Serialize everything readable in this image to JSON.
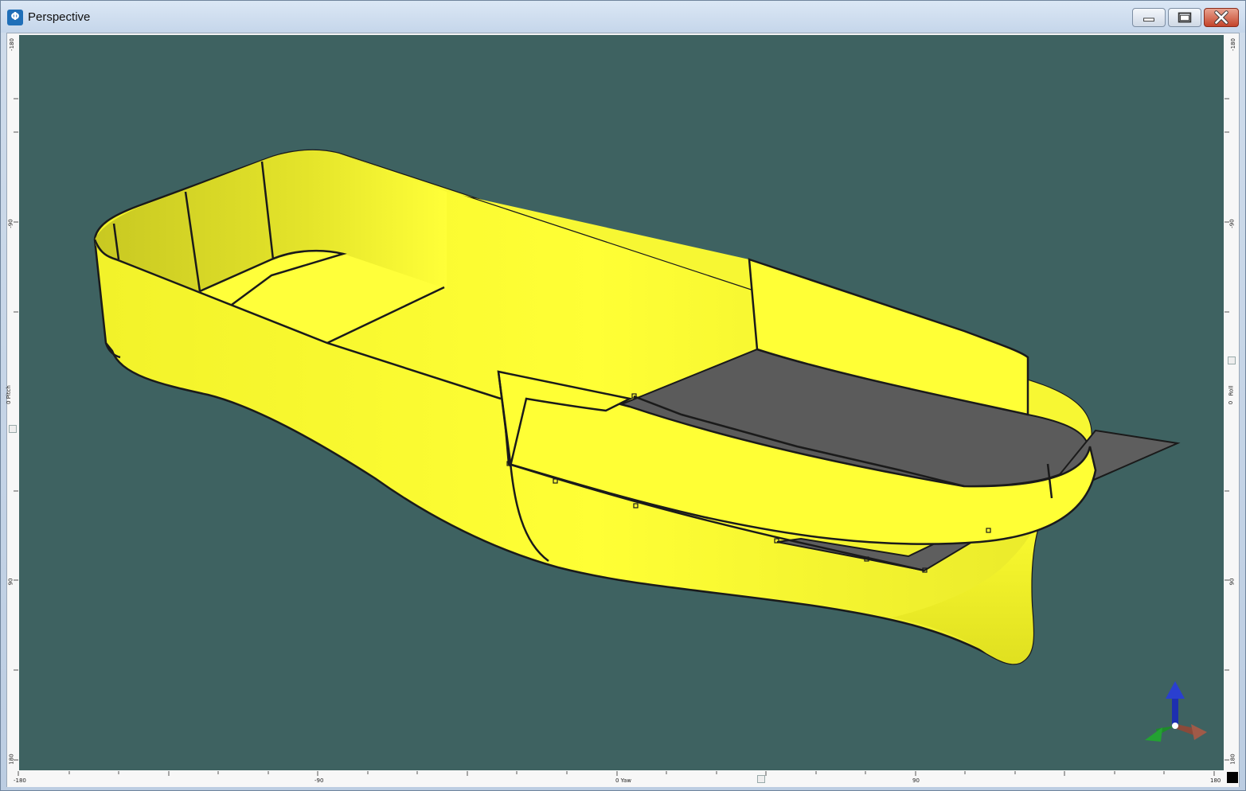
{
  "window": {
    "title": "Perspective",
    "icon": "maxsurf-app-icon"
  },
  "controls": [
    "minimize-icon",
    "maximize-icon",
    "close-icon"
  ],
  "colors": {
    "background": "#3e6261",
    "hull": "#ffff33",
    "deck": "#5a5a5a",
    "edges": "#1a1a1a"
  },
  "rulers": {
    "left": {
      "top": "-180",
      "upper_mid": "-90",
      "axis": "0 Pitch",
      "lower_mid": "90",
      "bottom": "180"
    },
    "right": {
      "top": "-180",
      "upper_mid": "-90",
      "axis": "Roll",
      "axis_value": "0",
      "lower_mid": "90",
      "bottom": "180"
    },
    "bottom": {
      "left": "-180",
      "left_mid": "-90",
      "axis": "0 Yaw",
      "right_mid": "90",
      "right": "180"
    }
  },
  "axis_triad": {
    "z_color": "#1d2fb0",
    "y_color": "#1e8a2a",
    "x_color": "#8a4a3a"
  }
}
